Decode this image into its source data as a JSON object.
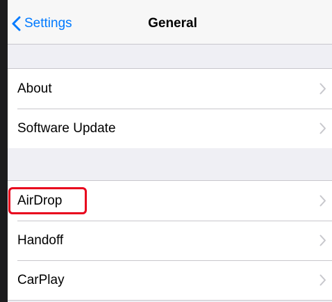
{
  "nav": {
    "back_label": "Settings",
    "back_icon": "chevron-left-icon",
    "title": "General"
  },
  "groups": [
    {
      "items": [
        {
          "label": "About",
          "icon": "chevron-right-icon"
        },
        {
          "label": "Software Update",
          "icon": "chevron-right-icon"
        }
      ]
    },
    {
      "items": [
        {
          "label": "AirDrop",
          "icon": "chevron-right-icon",
          "highlighted": true
        },
        {
          "label": "Handoff",
          "icon": "chevron-right-icon"
        },
        {
          "label": "CarPlay",
          "icon": "chevron-right-icon"
        }
      ]
    }
  ],
  "colors": {
    "accent": "#007aff",
    "highlight": "#e8001c",
    "background": "#efeff4",
    "cell": "#ffffff",
    "separator": "#c8c7cc",
    "chevron": "#c7c7cc"
  }
}
